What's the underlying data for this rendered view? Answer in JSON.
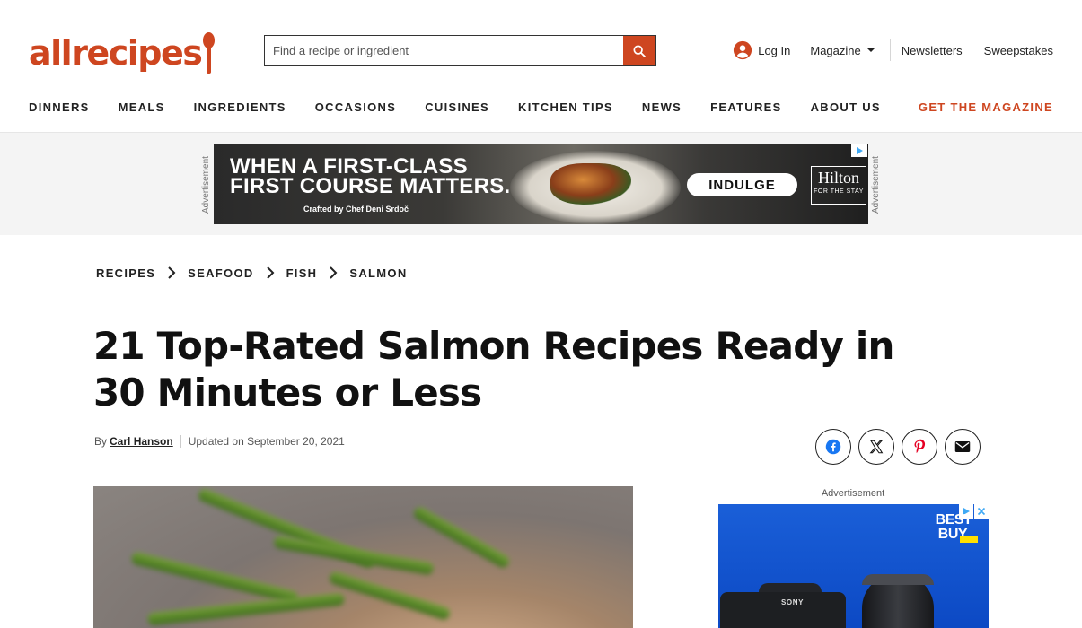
{
  "brand": {
    "logo_text": "allrecipes",
    "accent": "#ce4620"
  },
  "search": {
    "placeholder": "Find a recipe or ingredient",
    "icon": "search-icon"
  },
  "utility": {
    "login": "Log In",
    "magazine": "Magazine",
    "newsletters": "Newsletters",
    "sweepstakes": "Sweepstakes"
  },
  "nav": {
    "items": [
      "DINNERS",
      "MEALS",
      "INGREDIENTS",
      "OCCASIONS",
      "CUISINES",
      "KITCHEN TIPS",
      "NEWS",
      "FEATURES",
      "ABOUT US"
    ],
    "cta": "GET THE MAGAZINE"
  },
  "top_ad": {
    "label": "Advertisement",
    "headline_1": "WHEN A FIRST-CLASS",
    "headline_2": "FIRST COURSE MATTERS.",
    "sub": "Crafted by Chef Deni Srdoč",
    "cta": "INDULGE",
    "brand": "Hilton",
    "brand_tag": "FOR THE STAY"
  },
  "breadcrumb": [
    "RECIPES",
    "SEAFOOD",
    "FISH",
    "SALMON"
  ],
  "article": {
    "title": "21 Top-Rated Salmon Recipes Ready in 30 Minutes or Less",
    "by": "By",
    "author": "Carl Hanson",
    "updated": "Updated on September 20, 2021"
  },
  "share": [
    "facebook-icon",
    "x-icon",
    "pinterest-icon",
    "email-icon"
  ],
  "side_ad": {
    "label": "Advertisement",
    "brand_1": "BEST",
    "brand_2": "BUY.",
    "camera_brand": "SONY"
  }
}
